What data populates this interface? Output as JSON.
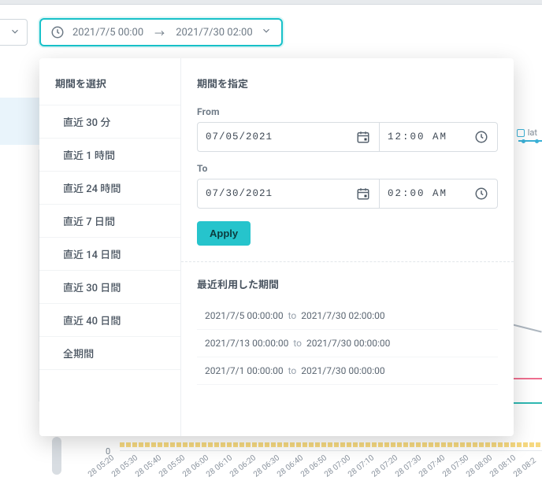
{
  "range_button": {
    "from": "2021/7/5 00:00",
    "to": "2021/7/30 02:00",
    "arrow": "→"
  },
  "presets": {
    "title": "期間を選択",
    "items": [
      "直近 30 分",
      "直近 1 時間",
      "直近 24 時間",
      "直近 7 日間",
      "直近 14 日間",
      "直近 30 日間",
      "直近 40 日間",
      "全期間"
    ]
  },
  "custom": {
    "title": "期間を指定",
    "from_label": "From",
    "to_label": "To",
    "from_date": "07/05/2021",
    "from_time": "12:00 AM",
    "to_date": "07/30/2021",
    "to_time": "02:00 AM",
    "apply": "Apply"
  },
  "recent": {
    "title": "最近利用した期間",
    "to_word": "to",
    "items": [
      {
        "from": "2021/7/5 00:00:00",
        "to": "2021/7/30 02:00:00"
      },
      {
        "from": "2021/7/13 00:00:00",
        "to": "2021/7/30 00:00:00"
      },
      {
        "from": "2021/7/1 00:00:00",
        "to": "2021/7/30 00:00:00"
      }
    ]
  },
  "chart": {
    "legend_fragment": "lat",
    "y_zero": "0",
    "xticks": [
      "28 05:20",
      "28 05:30",
      "28 05:40",
      "28 05:50",
      "28 06:00",
      "28 06:10",
      "28 06:20",
      "28 06:30",
      "28 06:40",
      "28 06:50",
      "28 07:00",
      "28 07:10",
      "28 07:20",
      "28 07:30",
      "28 07:40",
      "28 07:50",
      "28 08:00",
      "28 08:10",
      "28 08:2"
    ]
  },
  "colors": {
    "accent": "#18c1c9",
    "apply_bg": "#26c4cc",
    "series_blue": "#3bb0d6",
    "series_pink": "#ee6f8f",
    "series_teal": "#2fb8b2",
    "series_yellow": "#f3c94b"
  }
}
